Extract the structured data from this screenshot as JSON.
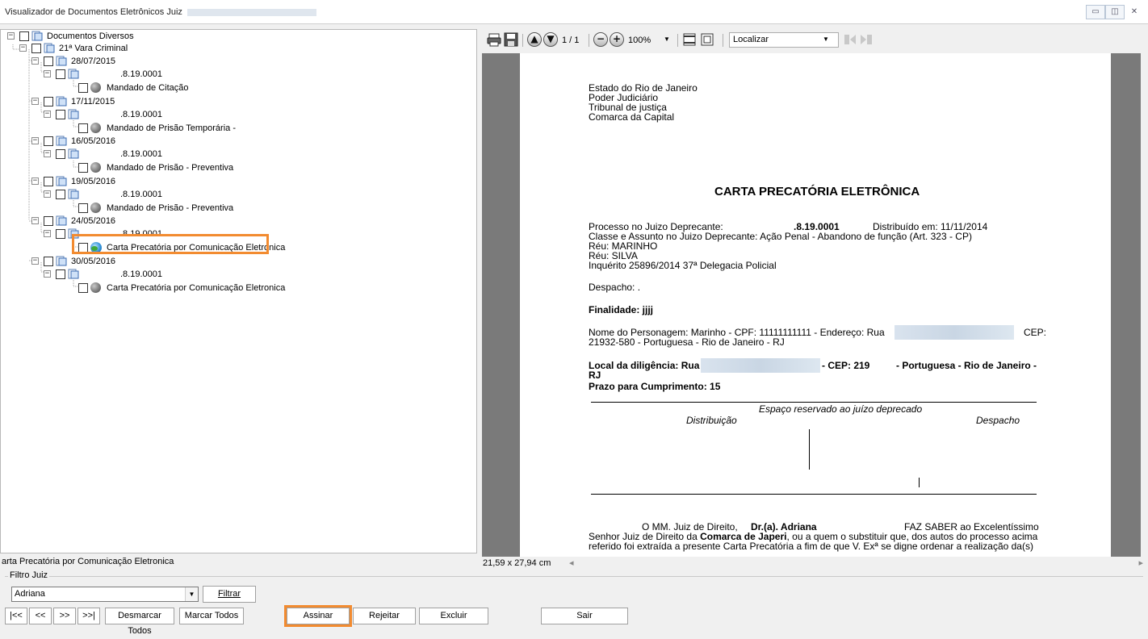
{
  "window": {
    "title": "Visualizador de Documentos Eletrônicos Juiz",
    "controls": [
      "minimize",
      "restore",
      "close"
    ]
  },
  "tree": {
    "root": "Documentos Diversos",
    "court": "21ª Vara Criminal",
    "groups": [
      {
        "date": "28/07/2015",
        "process": ".8.19.0001",
        "doc": "Mandado de Citação",
        "icon": "gray-ball-icon"
      },
      {
        "date": "17/11/2015",
        "process": ".8.19.0001",
        "doc": "Mandado de Prisão Temporária -",
        "icon": "gray-ball-icon"
      },
      {
        "date": "16/05/2016",
        "process": ".8.19.0001",
        "doc": "Mandado de Prisão - Preventiva",
        "icon": "gray-ball-icon"
      },
      {
        "date": "19/05/2016",
        "process": ".8.19.0001",
        "doc": "Mandado de Prisão - Preventiva",
        "icon": "gray-ball-icon"
      },
      {
        "date": "24/05/2016",
        "process": ".8.19.0001",
        "doc": "Carta Precatória por Comunicação Eletronica",
        "icon": "globe-icon"
      },
      {
        "date": "30/05/2016",
        "process": ".8.19.0001",
        "doc": "Carta Precatória por Comunicação Eletronica",
        "icon": "gray-ball-icon"
      }
    ],
    "status": "arta Precatória por Comunicação Eletronica"
  },
  "pdf_toolbar": {
    "page_indicator": "1 / 1",
    "zoom": "100%",
    "find_placeholder": "Localizar"
  },
  "document": {
    "header": [
      "Estado do Rio de Janeiro",
      "Poder Judiciário",
      "Tribunal de justiça",
      "Comarca da Capital"
    ],
    "title": "CARTA PRECATÓRIA ELETRÔNICA",
    "processo_label": "Processo no Juizo Deprecante:",
    "processo_value": ".8.19.0001",
    "distribuido": "Distribuído em: 11/11/2014",
    "classe": "Classe e Assunto no Juizo Deprecante: Ação Penal - Abandono de função   (Art. 323 - CP)",
    "reu1": "Réu: MARINHO",
    "reu2": "Réu: SILVA",
    "inquerito": "Inquérito  25896/2014     37ª Delegacia Policial",
    "despacho": "Despacho: .",
    "finalidade": "Finalidade: jjjj",
    "personagem_a": "Nome do Personagem: Marinho - CPF: 11111111111 - Endereço: Rua",
    "personagem_cep": "CEP:",
    "personagem_b": "21932-580 - Portuguesa - Rio de Janeiro - RJ",
    "local_a": "Local da diligência: Rua",
    "local_cep": "- CEP: 219",
    "local_b": "- Portuguesa - Rio de Janeiro -",
    "local_c": "RJ",
    "prazo": "Prazo para Cumprimento: 15",
    "espaco": "Espaço reservado ao juízo deprecado",
    "distribuicao": "Distribuição",
    "despacho2": "Despacho",
    "p1_a": "O MM. Juiz de Direito,",
    "p1_b": "Dr.(a). Adriana",
    "p1_c": "FAZ SABER ao Excelentíssimo",
    "p2_a": "Senhor Juiz de Direito da",
    "p2_b": "Comarca de Japeri",
    "p2_c": ", ou a quem o substituir que, dos autos do processo acima",
    "p3": "referido foi extraída a presente Carta Precatória a fim de que V. Exª se digne ordenar a realização da(s)"
  },
  "page_size": "21,59 x 27,94 cm",
  "filter": {
    "legend": "Filtro Juiz",
    "selected": "Adriana",
    "filter_button": "Filtrar"
  },
  "buttons": {
    "first": "|<<",
    "prev": "<<",
    "next": ">>",
    "last": ">>|",
    "unmark_all": "Desmarcar Todos",
    "mark_all": "Marcar Todos",
    "sign": "Assinar",
    "reject": "Rejeitar",
    "delete": "Excluir",
    "exit": "Sair"
  },
  "colors": {
    "highlight": "#f28b30",
    "viewport_bg": "#7a7a7a"
  }
}
